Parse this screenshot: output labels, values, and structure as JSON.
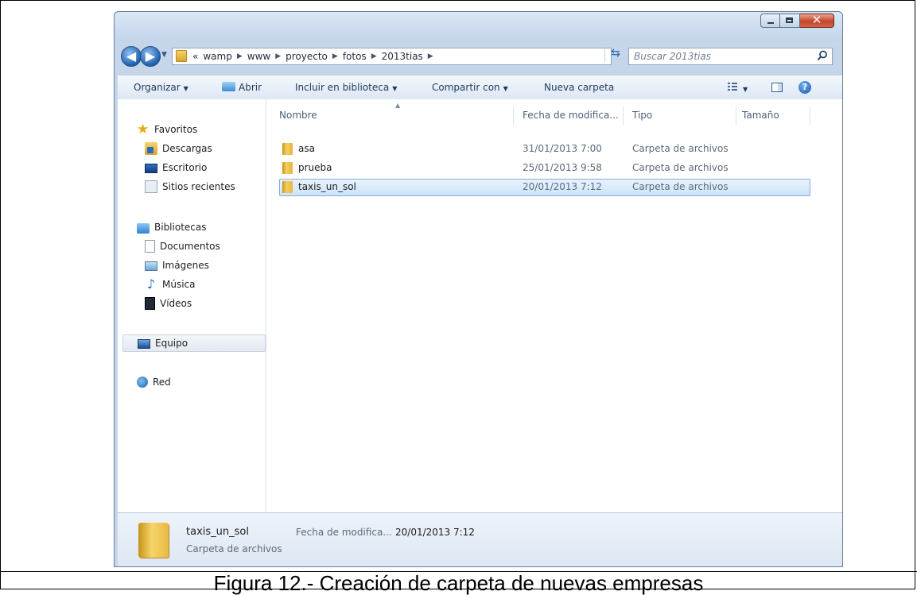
{
  "address": {
    "crumbs": [
      "«",
      "wamp",
      "www",
      "proyecto",
      "fotos",
      "2013tias"
    ],
    "search_placeholder": "Buscar 2013tias"
  },
  "toolbar": {
    "organize": "Organizar",
    "open": "Abrir",
    "include_library": "Incluir en biblioteca",
    "share_with": "Compartir con",
    "new_folder": "Nueva carpeta"
  },
  "nav": {
    "favorites": "Favoritos",
    "downloads": "Descargas",
    "desktop": "Escritorio",
    "recent": "Sitios recientes",
    "libraries": "Bibliotecas",
    "documents": "Documentos",
    "pictures": "Imágenes",
    "music": "Música",
    "videos": "Vídeos",
    "computer": "Equipo",
    "network": "Red"
  },
  "columns": {
    "name": "Nombre",
    "date": "Fecha de modifica...",
    "type": "Tipo",
    "size": "Tamaño"
  },
  "files": [
    {
      "name": "asa",
      "date": "31/01/2013 7:00",
      "type": "Carpeta de archivos"
    },
    {
      "name": "prueba",
      "date": "25/01/2013 9:58",
      "type": "Carpeta de archivos"
    },
    {
      "name": "taxis_un_sol",
      "date": "20/01/2013 7:12",
      "type": "Carpeta de archivos"
    }
  ],
  "details": {
    "name": "taxis_un_sol",
    "type": "Carpeta de archivos",
    "date_label": "Fecha de modifica...",
    "date_value": "20/01/2013 7:12"
  },
  "caption": "Figura 12.- Creación de carpeta de nuevas empresas",
  "colors": {
    "selection": "#cce4fa",
    "window_chrome": "#c5d6ea",
    "close_button": "#c64529"
  }
}
